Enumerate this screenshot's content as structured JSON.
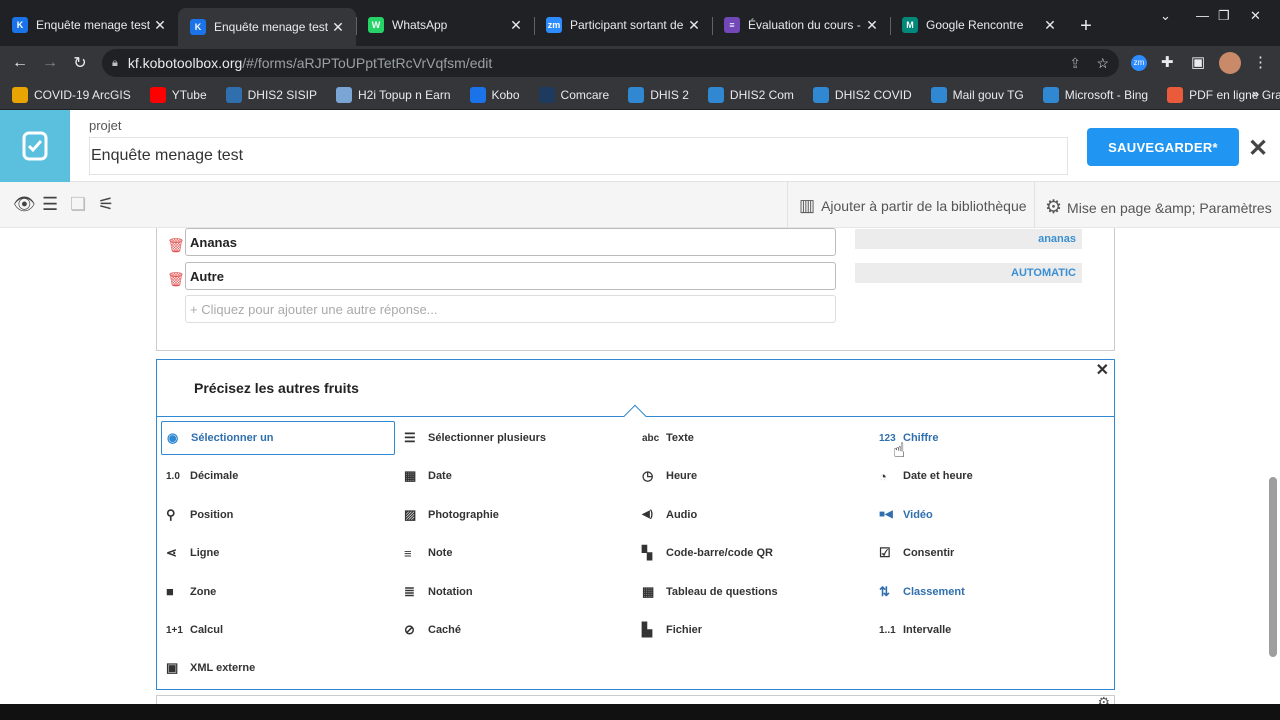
{
  "browser": {
    "tabs": [
      {
        "title": "Enquête menage test | K",
        "favicon": "K",
        "color": "#1a73e8",
        "active": false
      },
      {
        "title": "Enquête menage test | K",
        "favicon": "K",
        "color": "#1a73e8",
        "active": true
      },
      {
        "title": "WhatsApp",
        "favicon": "W",
        "color": "#25d366",
        "active": false
      },
      {
        "title": "Participant sortant de ré",
        "favicon": "zm",
        "color": "#2d8cff",
        "active": false
      },
      {
        "title": "Évaluation du cours - G",
        "favicon": "≡",
        "color": "#7248b9",
        "active": false
      },
      {
        "title": "Google Rencontre",
        "favicon": "M",
        "color": "#00897b",
        "active": false
      }
    ],
    "new_tab": "+",
    "url_domain": "kf.kobotoolbox.org",
    "url_path": "/#/forms/aRJPToUPptTetRcVrVqfsm/edit",
    "bookmarks": [
      {
        "label": "COVID-19 ArcGIS",
        "color": "#e8a400"
      },
      {
        "label": "YTube",
        "color": "#ff0000"
      },
      {
        "label": "DHIS2 SISIP",
        "color": "#2f6fae"
      },
      {
        "label": "H2i Topup n Earn",
        "color": "#7aa6d6"
      },
      {
        "label": "Kobo",
        "color": "#1a73e8"
      },
      {
        "label": "Comcare",
        "color": "#1e3a5f"
      },
      {
        "label": "DHIS 2",
        "color": "#2f88d1"
      },
      {
        "label": "DHIS2 Com",
        "color": "#2f88d1"
      },
      {
        "label": "DHIS2 COVID",
        "color": "#2f88d1"
      },
      {
        "label": "Mail gouv TG",
        "color": "#2f88d1"
      },
      {
        "label": "Microsoft - Bing",
        "color": "#2f88d1"
      },
      {
        "label": "PDF en ligne Gratuit",
        "color": "#e95b3b"
      }
    ]
  },
  "header": {
    "project_label": "projet",
    "project_name": "Enquête menage test",
    "save_label": "SAUVEGARDER*",
    "close": "✕"
  },
  "toolbar": {
    "library_label": "Ajouter à partir de la bibliothèque",
    "settings_label": "Mise en page &amp; Paramètres"
  },
  "choices": [
    {
      "label": "Ananas",
      "value": "ananas"
    },
    {
      "label": "Autre",
      "value": "AUTOMATIC"
    }
  ],
  "add_response_placeholder": "+ Cliquez pour ajouter une autre réponse...",
  "question": {
    "title": "Précisez les autres fruits",
    "close": "✕"
  },
  "question_types": [
    {
      "label": "Sélectionner un",
      "icon": "radio-icon",
      "glyph": "◉",
      "selected": true
    },
    {
      "label": "Sélectionner plusieurs",
      "icon": "list-icon",
      "glyph": "☰"
    },
    {
      "label": "Texte",
      "icon": "text-icon",
      "glyph": "abc"
    },
    {
      "label": "Chiffre",
      "icon": "number-icon",
      "glyph": "123",
      "blue": true
    },
    {
      "label": "Décimale",
      "icon": "decimal-icon",
      "glyph": "1.0"
    },
    {
      "label": "Date",
      "icon": "calendar-icon",
      "glyph": "▦"
    },
    {
      "label": "Heure",
      "icon": "clock-icon",
      "glyph": "◷"
    },
    {
      "label": "Date et heure",
      "icon": "datetime-icon",
      "glyph": "◔"
    },
    {
      "label": "Position",
      "icon": "pin-icon",
      "glyph": "⚲"
    },
    {
      "label": "Photographie",
      "icon": "photo-icon",
      "glyph": "▨"
    },
    {
      "label": "Audio",
      "icon": "audio-icon",
      "glyph": "◀)"
    },
    {
      "label": "Vidéo",
      "icon": "video-icon",
      "glyph": "■◀",
      "blue": true
    },
    {
      "label": "Ligne",
      "icon": "share-icon",
      "glyph": "⋖"
    },
    {
      "label": "Note",
      "icon": "note-icon",
      "glyph": "≡"
    },
    {
      "label": "Code-barre/code QR",
      "icon": "qr-icon",
      "glyph": "▚"
    },
    {
      "label": "Consentir",
      "icon": "checkbox-icon",
      "glyph": "☑"
    },
    {
      "label": "Zone",
      "icon": "square-icon",
      "glyph": "■"
    },
    {
      "label": "Notation",
      "icon": "rating-icon",
      "glyph": "≣"
    },
    {
      "label": "Tableau de questions",
      "icon": "table-icon",
      "glyph": "▦"
    },
    {
      "label": "Classement",
      "icon": "sort-icon",
      "glyph": "⇅",
      "blue": true
    },
    {
      "label": "Calcul",
      "icon": "calc-icon",
      "glyph": "1+1"
    },
    {
      "label": "Caché",
      "icon": "hidden-icon",
      "glyph": "⊘"
    },
    {
      "label": "Fichier",
      "icon": "file-icon",
      "glyph": "▙"
    },
    {
      "label": "Intervalle",
      "icon": "range-icon",
      "glyph": "1..1"
    },
    {
      "label": "XML externe",
      "icon": "xml-icon",
      "glyph": "▣"
    }
  ]
}
